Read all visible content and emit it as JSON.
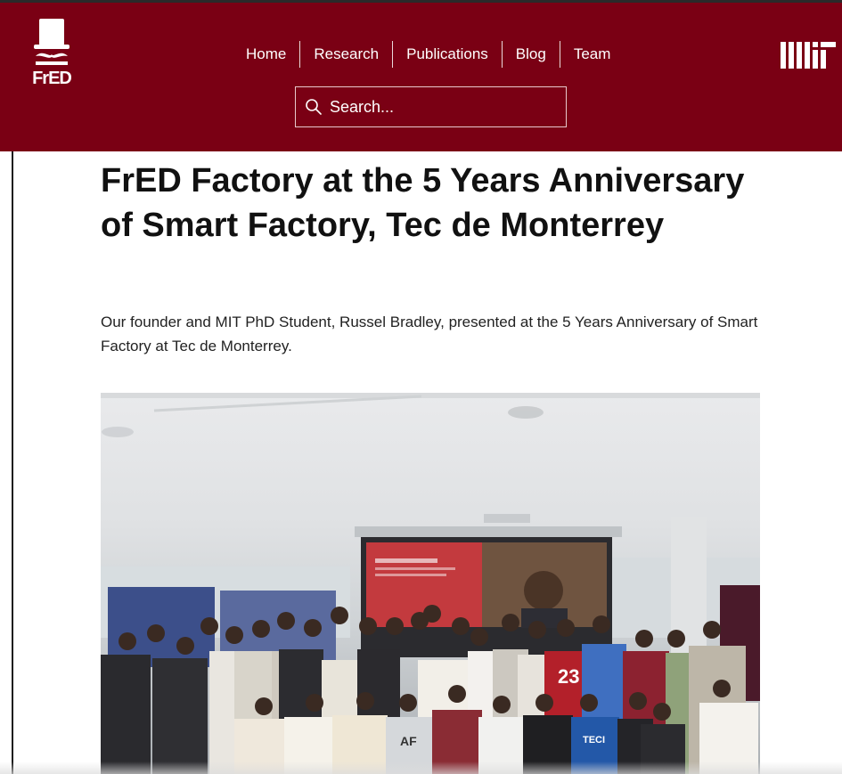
{
  "brand": {
    "logo_text": "FrED",
    "header_color": "#7a0014",
    "partner_logo": "MIT"
  },
  "nav": {
    "items": [
      "Home",
      "Research",
      "Publications",
      "Blog",
      "Team"
    ]
  },
  "search": {
    "placeholder": "Search...",
    "icon": "search-icon"
  },
  "post": {
    "title": "FrED Factory at the 5 Years Anniversary of Smart Factory, Tec de Monterrey",
    "description": "Our founder and MIT PhD Student, Russel Bradley, presented at the 5 Years Anniversary of Smart Factory at Tec de Monterrey.",
    "photo_jersey_number": "23",
    "photo_shirt_text": "TECI",
    "photo_shirt_text_2": "AF"
  }
}
